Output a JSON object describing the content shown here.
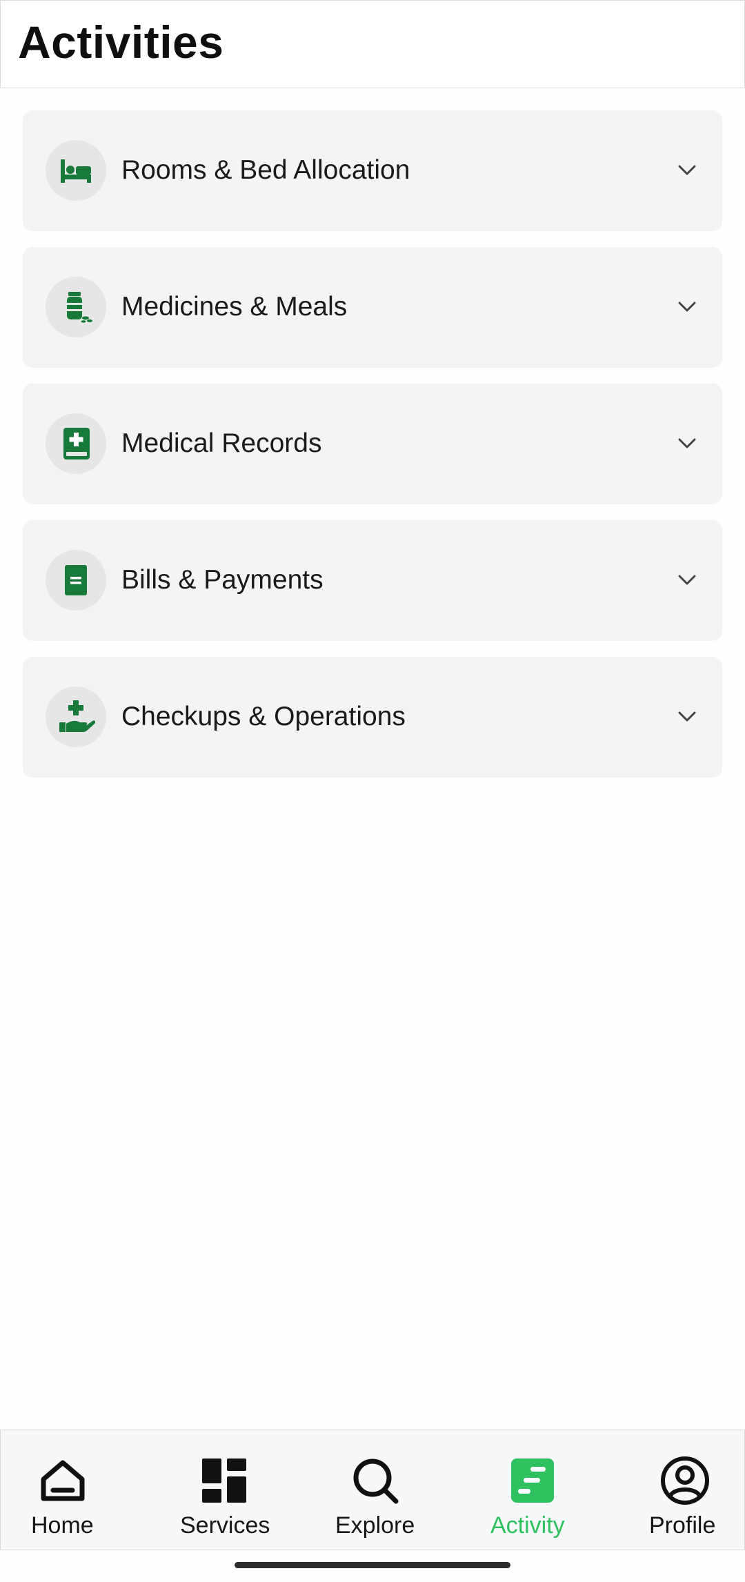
{
  "header": {
    "title": "Activities"
  },
  "accordion": {
    "items": [
      {
        "label": "Rooms & Bed Allocation",
        "icon": "bed-icon"
      },
      {
        "label": "Medicines & Meals",
        "icon": "medicine-bottle-icon"
      },
      {
        "label": "Medical Records",
        "icon": "medical-book-icon"
      },
      {
        "label": "Bills & Payments",
        "icon": "bill-icon"
      },
      {
        "label": "Checkups & Operations",
        "icon": "hand-holding-medical-icon"
      }
    ],
    "chevron_icon": "chevron-down-icon"
  },
  "tabbar": {
    "tabs": [
      {
        "label": "Home",
        "icon": "home-icon",
        "active": false
      },
      {
        "label": "Services",
        "icon": "dashboard-icon",
        "active": false
      },
      {
        "label": "Explore",
        "icon": "search-icon",
        "active": false
      },
      {
        "label": "Activity",
        "icon": "activity-icon",
        "active": true
      },
      {
        "label": "Profile",
        "icon": "profile-icon",
        "active": false
      }
    ]
  },
  "colors": {
    "brand_green": "#177a3a",
    "active_tab": "#2fc060",
    "card_bg": "#f4f4f4",
    "icon_circle_bg": "#e6e6e6",
    "tabbar_bg": "#f7f8fa"
  }
}
